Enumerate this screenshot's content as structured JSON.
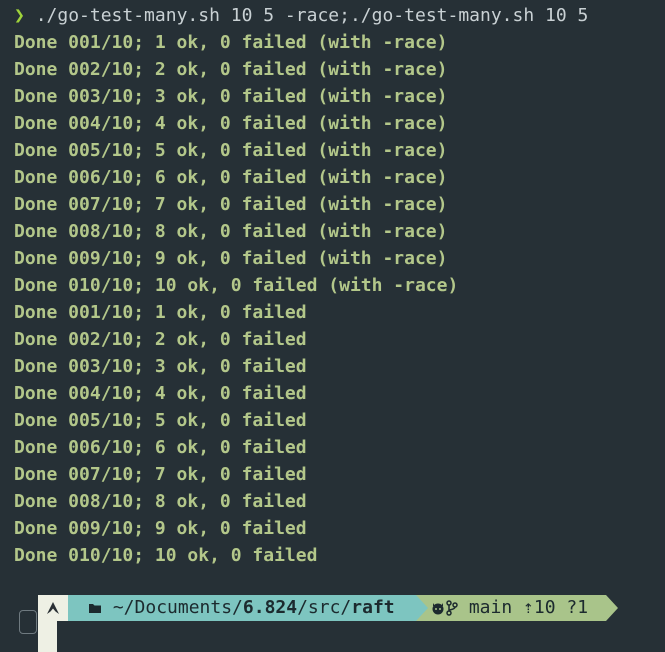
{
  "command": {
    "prompt_symbol": "❯",
    "text": "./go-test-many.sh 10 5 -race;./go-test-many.sh 10 5"
  },
  "output_lines": [
    "Done 001/10; 1 ok, 0 failed (with -race)",
    "Done 002/10; 2 ok, 0 failed (with -race)",
    "Done 003/10; 3 ok, 0 failed (with -race)",
    "Done 004/10; 4 ok, 0 failed (with -race)",
    "Done 005/10; 5 ok, 0 failed (with -race)",
    "Done 006/10; 6 ok, 0 failed (with -race)",
    "Done 007/10; 7 ok, 0 failed (with -race)",
    "Done 008/10; 8 ok, 0 failed (with -race)",
    "Done 009/10; 9 ok, 0 failed (with -race)",
    "Done 010/10; 10 ok, 0 failed (with -race)",
    "Done 001/10; 1 ok, 0 failed",
    "Done 002/10; 2 ok, 0 failed",
    "Done 003/10; 3 ok, 0 failed",
    "Done 004/10; 4 ok, 0 failed",
    "Done 005/10; 5 ok, 0 failed",
    "Done 006/10; 6 ok, 0 failed",
    "Done 007/10; 7 ok, 0 failed",
    "Done 008/10; 8 ok, 0 failed",
    "Done 009/10; 9 ok, 0 failed",
    "Done 010/10; 10 ok, 0 failed"
  ],
  "prompt": {
    "os_icon": "arch-linux-icon",
    "dir_prefix": "~/Documents/",
    "dir_bold": "6.824",
    "dir_suffix": "/src/",
    "dir_last": "raft",
    "git_icon": "github-icon",
    "branch_icon": "git-branch-icon",
    "branch": "main",
    "ahead": "⇡10",
    "untracked": "?1"
  },
  "colors": {
    "background": "#263036",
    "output_text": "#b3c78a",
    "chevron": "#9fd33b",
    "dir_segment": "#7dc5c0",
    "git_segment": "#a9c48a"
  }
}
